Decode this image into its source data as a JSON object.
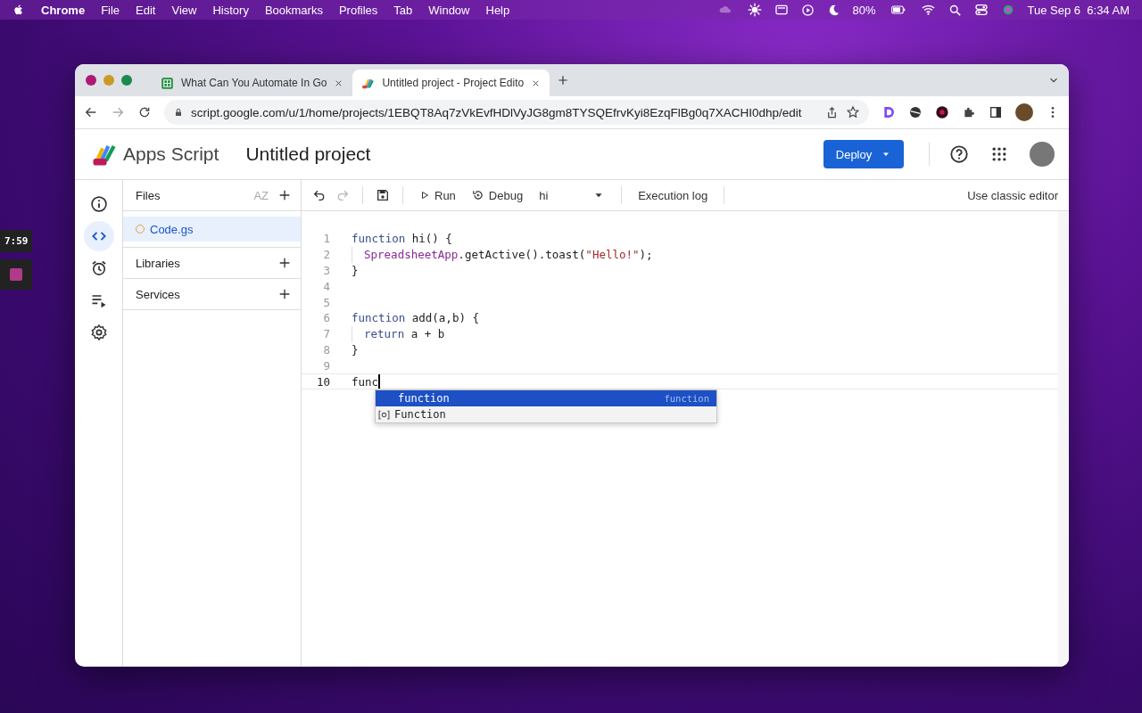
{
  "menubar": {
    "app": "Chrome",
    "menus": [
      "File",
      "Edit",
      "View",
      "History",
      "Bookmarks",
      "Profiles",
      "Tab",
      "Window",
      "Help"
    ],
    "battery": "80%",
    "clock": "Tue Sep 6  6:34 AM"
  },
  "desktop_widget": {
    "timer": "7:59"
  },
  "browser": {
    "tabs": [
      {
        "title": "What Can You Automate In Go",
        "selected": false
      },
      {
        "title": "Untitled project - Project Edito",
        "selected": true
      }
    ],
    "url": "script.google.com/u/1/home/projects/1EBQT8Aq7zVkEvfHDlVyJG8gm8TYSQEfrvKyi8EzqFlBg0q7XACHI0dhp/edit"
  },
  "header": {
    "brand": "Apps Script",
    "project": "Untitled project",
    "deploy": "Deploy"
  },
  "rail": [
    {
      "kind": "info",
      "selected": false
    },
    {
      "kind": "code",
      "selected": true
    },
    {
      "kind": "alarm",
      "selected": false
    },
    {
      "kind": "executions",
      "selected": false
    },
    {
      "kind": "settings",
      "selected": false
    }
  ],
  "files_panel": {
    "title": "Files",
    "sort_label": "AZ",
    "files": [
      {
        "name": "Code.gs",
        "selected": true
      }
    ],
    "sections": [
      "Libraries",
      "Services"
    ]
  },
  "toolbar": {
    "redo_disabled": true,
    "run": "Run",
    "debug": "Debug",
    "function": "hi",
    "execution_log": "Execution log",
    "classic": "Use classic editor"
  },
  "code": {
    "lines": [
      {
        "number": "1",
        "indent": false,
        "current": false,
        "tokens": [
          {
            "kind": "keyword",
            "text": "function"
          },
          {
            "kind": "plain",
            "text": " hi() {"
          }
        ]
      },
      {
        "number": "2",
        "indent": true,
        "current": false,
        "tokens": [
          {
            "kind": "class",
            "text": "SpreadsheetApp"
          },
          {
            "kind": "plain",
            "text": ".getActive().toast("
          },
          {
            "kind": "string",
            "text": "\"Hello!\""
          },
          {
            "kind": "plain",
            "text": ");"
          }
        ]
      },
      {
        "number": "3",
        "indent": false,
        "current": false,
        "tokens": [
          {
            "kind": "plain",
            "text": "}"
          }
        ]
      },
      {
        "number": "4",
        "indent": false,
        "current": false
      },
      {
        "number": "5",
        "indent": false,
        "current": false
      },
      {
        "number": "6",
        "indent": false,
        "current": false,
        "tokens": [
          {
            "kind": "keyword",
            "text": "function"
          },
          {
            "kind": "plain",
            "text": " add(a,b) {"
          }
        ]
      },
      {
        "number": "7",
        "indent": true,
        "current": false,
        "tokens": [
          {
            "kind": "keyword",
            "text": "return"
          },
          {
            "kind": "plain",
            "text": " a + b"
          }
        ]
      },
      {
        "number": "8",
        "indent": false,
        "current": false,
        "tokens": [
          {
            "kind": "plain",
            "text": "}"
          }
        ]
      },
      {
        "number": "9",
        "indent": false,
        "current": false
      },
      {
        "number": "10",
        "indent": false,
        "current": true,
        "tokens": [
          {
            "kind": "plain",
            "text": "func"
          }
        ]
      }
    ],
    "suggestions": [
      {
        "kind": "keyword",
        "label": "function",
        "detail": "function",
        "selected": true
      },
      {
        "kind": "value",
        "label": "Function",
        "selected": false
      }
    ]
  }
}
